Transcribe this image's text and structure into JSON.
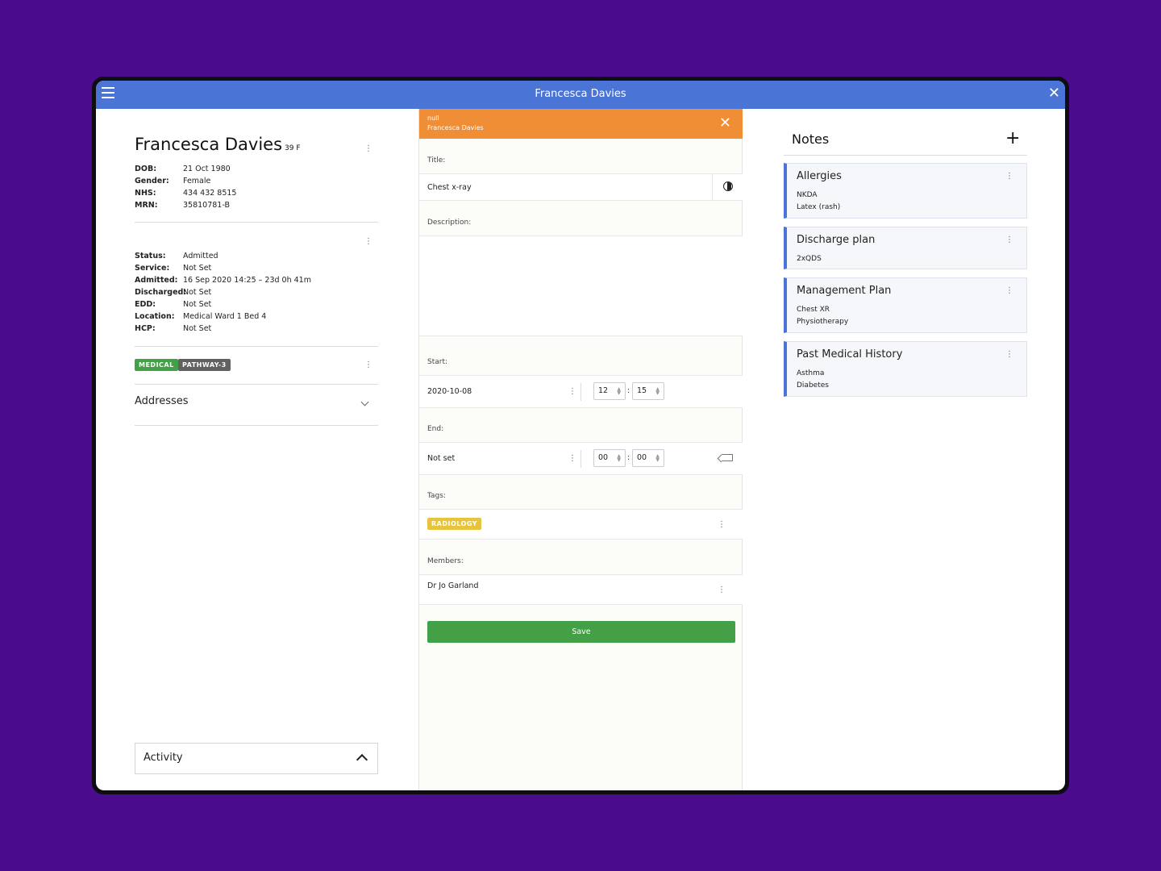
{
  "window": {
    "title": "Francesca Davies"
  },
  "patient": {
    "name": "Francesca Davies",
    "age_sex": "39 F",
    "details": [
      {
        "label": "DOB:",
        "value": "21 Oct 1980"
      },
      {
        "label": "Gender:",
        "value": "Female"
      },
      {
        "label": "NHS:",
        "value": "434 432 8515"
      },
      {
        "label": "MRN:",
        "value": "35810781-B"
      }
    ],
    "admission": [
      {
        "label": "Status:",
        "value": "Admitted"
      },
      {
        "label": "Service:",
        "value": "Not Set"
      },
      {
        "label": "Admitted:",
        "value": "16 Sep 2020 14:25 – 23d 0h 41m"
      },
      {
        "label": "Discharged:",
        "value": "Not Set"
      },
      {
        "label": "EDD:",
        "value": "Not Set"
      },
      {
        "label": "Location:",
        "value": "Medical Ward 1 Bed 4"
      },
      {
        "label": "HCP:",
        "value": "Not Set"
      }
    ],
    "tags": [
      {
        "label": "MEDICAL",
        "color": "#43a047"
      },
      {
        "label": "PATHWAY-3",
        "color": "#616161"
      }
    ],
    "addresses_label": "Addresses",
    "activity_label": "Activity"
  },
  "form": {
    "header_line1": "null",
    "header_line2": "Francesca Davies",
    "title_label": "Title:",
    "title_value": "Chest x-ray",
    "description_label": "Description:",
    "start_label": "Start:",
    "start_date": "2020-10-08",
    "start_hour": "12",
    "start_minute": "15",
    "end_label": "End:",
    "end_date": "Not set",
    "end_hour": "00",
    "end_minute": "00",
    "tags_label": "Tags:",
    "tag": "RADIOLOGY",
    "members_label": "Members:",
    "member": "Dr Jo Garland",
    "save_label": "Save"
  },
  "notes": {
    "title": "Notes",
    "cards": [
      {
        "title": "Allergies",
        "lines": [
          "NKDA",
          "Latex (rash)"
        ]
      },
      {
        "title": "Discharge plan",
        "lines": [
          "2xQDS"
        ]
      },
      {
        "title": "Management Plan",
        "lines": [
          "Chest XR",
          "Physiotherapy"
        ]
      },
      {
        "title": "Past Medical History",
        "lines": [
          "Asthma",
          "Diabetes"
        ]
      }
    ]
  },
  "colors": {
    "header_blue": "#4a74d6",
    "form_header_orange": "#f08e36",
    "save_green": "#43a047",
    "radiology_yellow": "#e8c43d",
    "background_purple": "#4a0b8c"
  }
}
